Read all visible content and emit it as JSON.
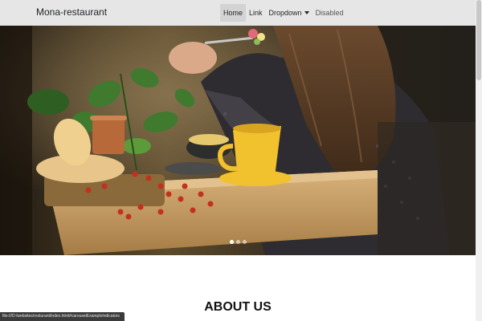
{
  "navbar": {
    "brand": "Mona-restaurant",
    "items": [
      {
        "label": "Home",
        "state": "active"
      },
      {
        "label": "Link",
        "state": "normal"
      },
      {
        "label": "Dropdown",
        "state": "dropdown"
      },
      {
        "label": "Disabled",
        "state": "disabled"
      }
    ]
  },
  "carousel": {
    "slides": 3,
    "active_slide": 1
  },
  "about": {
    "title": "ABOUT US"
  },
  "status_bar": {
    "url": "file:///D:/websites/resturant/index.html#carouselExampleIndicators"
  },
  "colors": {
    "navbar_bg": "#e6e6e6",
    "nav_active_bg": "#d3d3d3",
    "cup_yellow": "#f2c12e",
    "table_wood": "#c9a36a"
  }
}
